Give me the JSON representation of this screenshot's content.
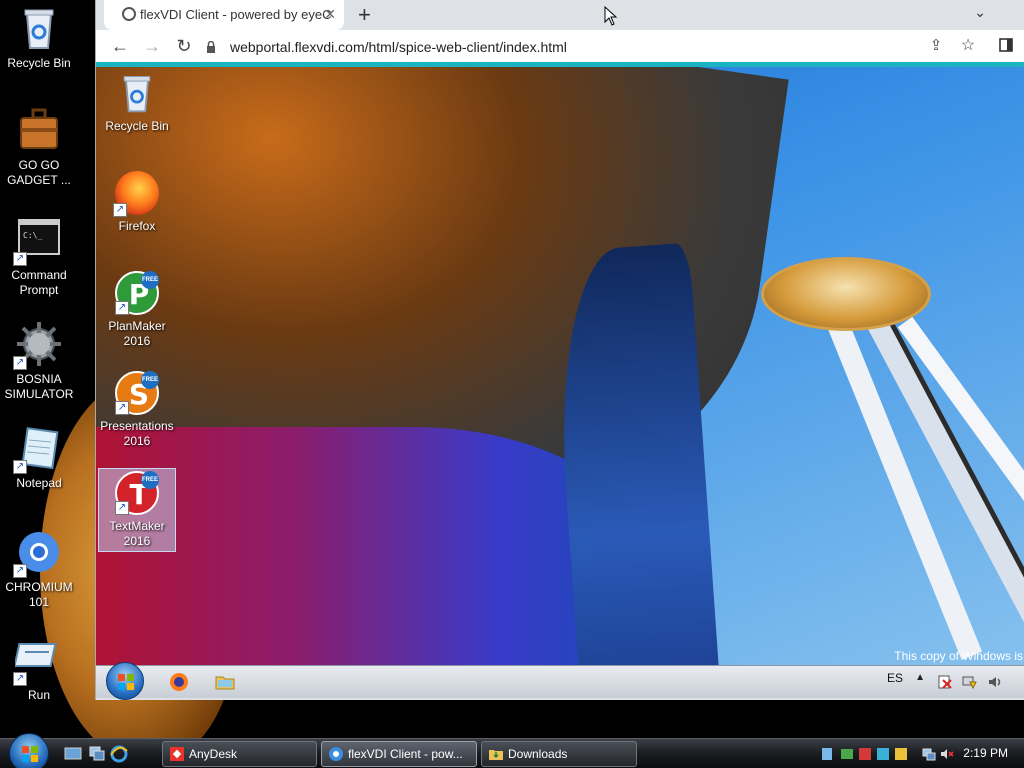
{
  "host_desktop": {
    "icons": [
      {
        "label": "Recycle Bin",
        "icon": "recycle-bin-icon"
      },
      {
        "label": "GO GO GADGET ...",
        "icon": "briefcase-icon"
      },
      {
        "label": "Command Prompt",
        "icon": "command-prompt-icon"
      },
      {
        "label": "BOSNIA SIMULATOR",
        "icon": "gear-ball-icon"
      },
      {
        "label": "Notepad",
        "icon": "notepad-icon"
      },
      {
        "label": "CHROMIUM 101",
        "icon": "chromium-icon"
      },
      {
        "label": "Run",
        "icon": "run-icon"
      }
    ]
  },
  "browser": {
    "tab_title": "flexVDI Client - powered by eyeC",
    "new_tab": "+",
    "url": "webportal.flexvdi.com/html/spice-web-client/index.html",
    "accent_color": "#1cb3c1"
  },
  "remote_desktop": {
    "icons": [
      {
        "label": "Recycle Bin",
        "icon": "recycle-bin-icon"
      },
      {
        "label": "Firefox",
        "icon": "firefox-icon"
      },
      {
        "label": "PlanMaker 2016",
        "icon": "planmaker-icon",
        "letter": "P",
        "badge": "FREE"
      },
      {
        "label": "Presentations 2016",
        "icon": "presentations-icon",
        "letter": "S",
        "badge": "FREE"
      },
      {
        "label": "TextMaker 2016",
        "icon": "textmaker-icon",
        "letter": "T",
        "badge": "FREE"
      }
    ],
    "watermark": "This copy of Windows is",
    "taskbar": {
      "lang": "ES",
      "tray_up": "▲"
    }
  },
  "host_taskbar": {
    "tasks": [
      {
        "label": "AnyDesk",
        "icon": "anydesk-icon"
      },
      {
        "label": "flexVDI Client - pow...",
        "icon": "chrome-icon"
      },
      {
        "label": "Downloads",
        "icon": "folder-icon"
      }
    ],
    "clock": "2:19 PM"
  }
}
